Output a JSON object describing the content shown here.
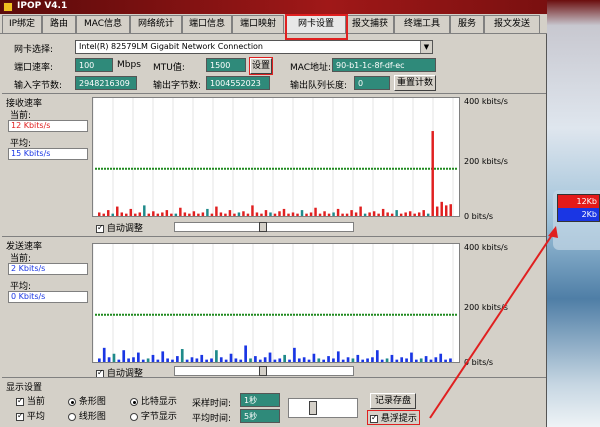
{
  "window": {
    "title": "IPOP V4.1"
  },
  "tabs": [
    {
      "label": "IP绑定"
    },
    {
      "label": "路由"
    },
    {
      "label": "MAC信息"
    },
    {
      "label": "网络统计"
    },
    {
      "label": "端口信息"
    },
    {
      "label": "端口映射"
    },
    {
      "label": "网卡设置"
    },
    {
      "label": "报文捕获"
    },
    {
      "label": "终端工具"
    },
    {
      "label": "服务"
    },
    {
      "label": "报文发送"
    }
  ],
  "nic": {
    "select_label": "网卡选择:",
    "select_value": "Intel(R) 82579LM Gigabit Network Connection",
    "speed_label": "端口速率:",
    "speed_value": "100",
    "speed_unit": "Mbps",
    "mtu_label": "MTU值:",
    "mtu_value": "1500",
    "set_button": "设置",
    "mac_label": "MAC地址:",
    "mac_value": "90-b1-1c-8f-df-ec",
    "in_bytes_label": "输入字节数:",
    "in_bytes_value": "2948216309",
    "out_bytes_label": "输出字节数:",
    "out_bytes_value": "1004552023",
    "queue_label": "输出队列长度:",
    "queue_value": "0",
    "reset_button": "重置计数"
  },
  "recv": {
    "title": "接收速率",
    "current_label": "当前:",
    "current_value": "12  Kbits/s",
    "avg_label": "平均:",
    "avg_value": "15  Kbits/s",
    "axis_top": "400  kbits/s",
    "axis_mid": "200  kbits/s",
    "axis_bot": "0  bits/s",
    "auto_label": "自动调整",
    "bar_color": "#e02020",
    "bars": [
      3,
      2,
      5,
      2,
      8,
      3,
      2,
      6,
      2,
      3,
      9,
      2,
      4,
      2,
      3,
      5,
      2,
      2,
      7,
      3,
      2,
      4,
      2,
      3,
      6,
      2,
      8,
      3,
      2,
      5,
      2,
      3,
      4,
      2,
      9,
      3,
      2,
      5,
      3,
      2,
      4,
      6,
      2,
      3,
      2,
      5,
      2,
      3,
      7,
      2,
      4,
      2,
      3,
      6,
      2,
      2,
      5,
      3,
      8,
      2,
      3,
      4,
      2,
      6,
      3,
      2,
      5,
      2,
      3,
      4,
      2,
      3,
      5,
      2,
      72,
      8,
      12,
      9,
      10
    ],
    "avg_level": 0.4
  },
  "send": {
    "title": "发送速率",
    "current_label": "当前:",
    "current_value": "2  Kbits/s",
    "avg_label": "平均:",
    "avg_value": "0  Kbits/s",
    "axis_top": "400  kbits/s",
    "axis_mid": "200  kbits/s",
    "axis_bot": "0  bits/s",
    "auto_label": "自动调整",
    "bar_color": "#1a36e4",
    "bars": [
      3,
      12,
      4,
      7,
      2,
      10,
      3,
      4,
      8,
      2,
      3,
      6,
      2,
      9,
      3,
      2,
      5,
      11,
      2,
      4,
      3,
      6,
      2,
      3,
      10,
      4,
      2,
      7,
      3,
      2,
      14,
      3,
      5,
      2,
      4,
      8,
      2,
      3,
      6,
      2,
      12,
      3,
      4,
      2,
      7,
      3,
      2,
      5,
      3,
      9,
      2,
      4,
      3,
      6,
      2,
      3,
      4,
      10,
      2,
      3,
      6,
      2,
      4,
      3,
      8,
      2,
      3,
      5,
      2,
      4,
      7,
      2,
      3
    ],
    "avg_level": 0.4
  },
  "display": {
    "title": "显示设置",
    "current_cb": "当前",
    "avg_cb": "平均",
    "bar_radio": "条形图",
    "line_radio": "线形图",
    "bit_radio": "比特显示",
    "byte_radio": "字节显示",
    "sample_label": "采样时间:",
    "sample_value": "1秒",
    "avg_time_label": "平均时间:",
    "avg_time_value": "5秒",
    "save_button": "记录存盘",
    "float_label": "悬浮提示"
  },
  "floating": {
    "recv": "12Kb",
    "send": "2Kb"
  }
}
